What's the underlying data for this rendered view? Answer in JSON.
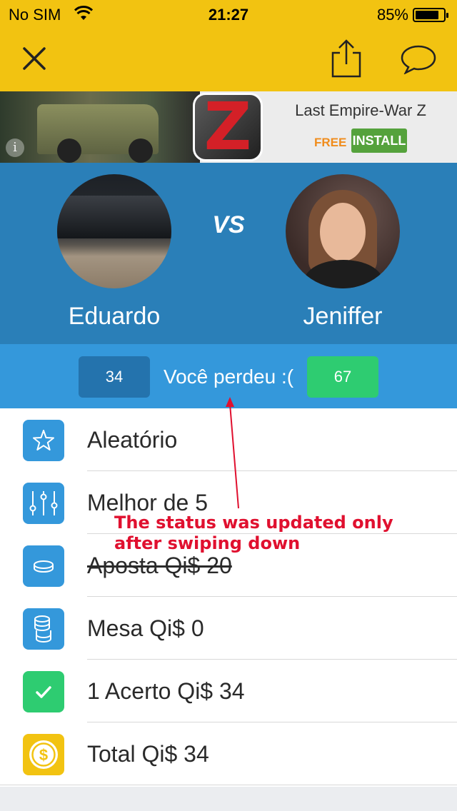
{
  "status_bar": {
    "carrier": "No SIM",
    "time": "21:27",
    "battery_percent": "85%",
    "battery_level": 0.85
  },
  "toolbar": {
    "close_icon": "close-icon",
    "share_icon": "share-icon",
    "chat_icon": "chat-bubble-icon"
  },
  "ad": {
    "title": "Last Empire-War Z",
    "price": "FREE",
    "install_label": "INSTALL",
    "app_icon_letter": "Z",
    "info_glyph": "i"
  },
  "match": {
    "vs_label": "VS",
    "player_left": {
      "name": "Eduardo",
      "score": "34"
    },
    "player_right": {
      "name": "Jeniffer",
      "score": "67"
    },
    "result_text": "Você perdeu :("
  },
  "details": [
    {
      "icon": "star-icon",
      "icon_color": "#3498db",
      "label": "Aleatório",
      "struck": false
    },
    {
      "icon": "sliders-icon",
      "icon_color": "#3498db",
      "label": "Melhor de 5",
      "struck": false
    },
    {
      "icon": "coin-icon",
      "icon_color": "#3498db",
      "label": "Aposta Qi$ 20",
      "struck": true
    },
    {
      "icon": "coin-stack-icon",
      "icon_color": "#3498db",
      "label": "Mesa Qi$ 0",
      "struck": false
    },
    {
      "icon": "checkmark-icon",
      "icon_color": "#2ecc71",
      "label": "1 Acerto Qi$ 34",
      "struck": false
    },
    {
      "icon": "dollar-coin-icon",
      "icon_color": "#f2c311",
      "label": "Total Qi$ 34",
      "struck": false
    }
  ],
  "annotation": {
    "line1": "The status was updated only",
    "line2": "after swiping down",
    "color": "#e0102f"
  },
  "colors": {
    "header_yellow": "#f2c311",
    "players_blue": "#2a7fb8",
    "scorebar_blue": "#3498db",
    "win_green": "#2ecc71"
  }
}
